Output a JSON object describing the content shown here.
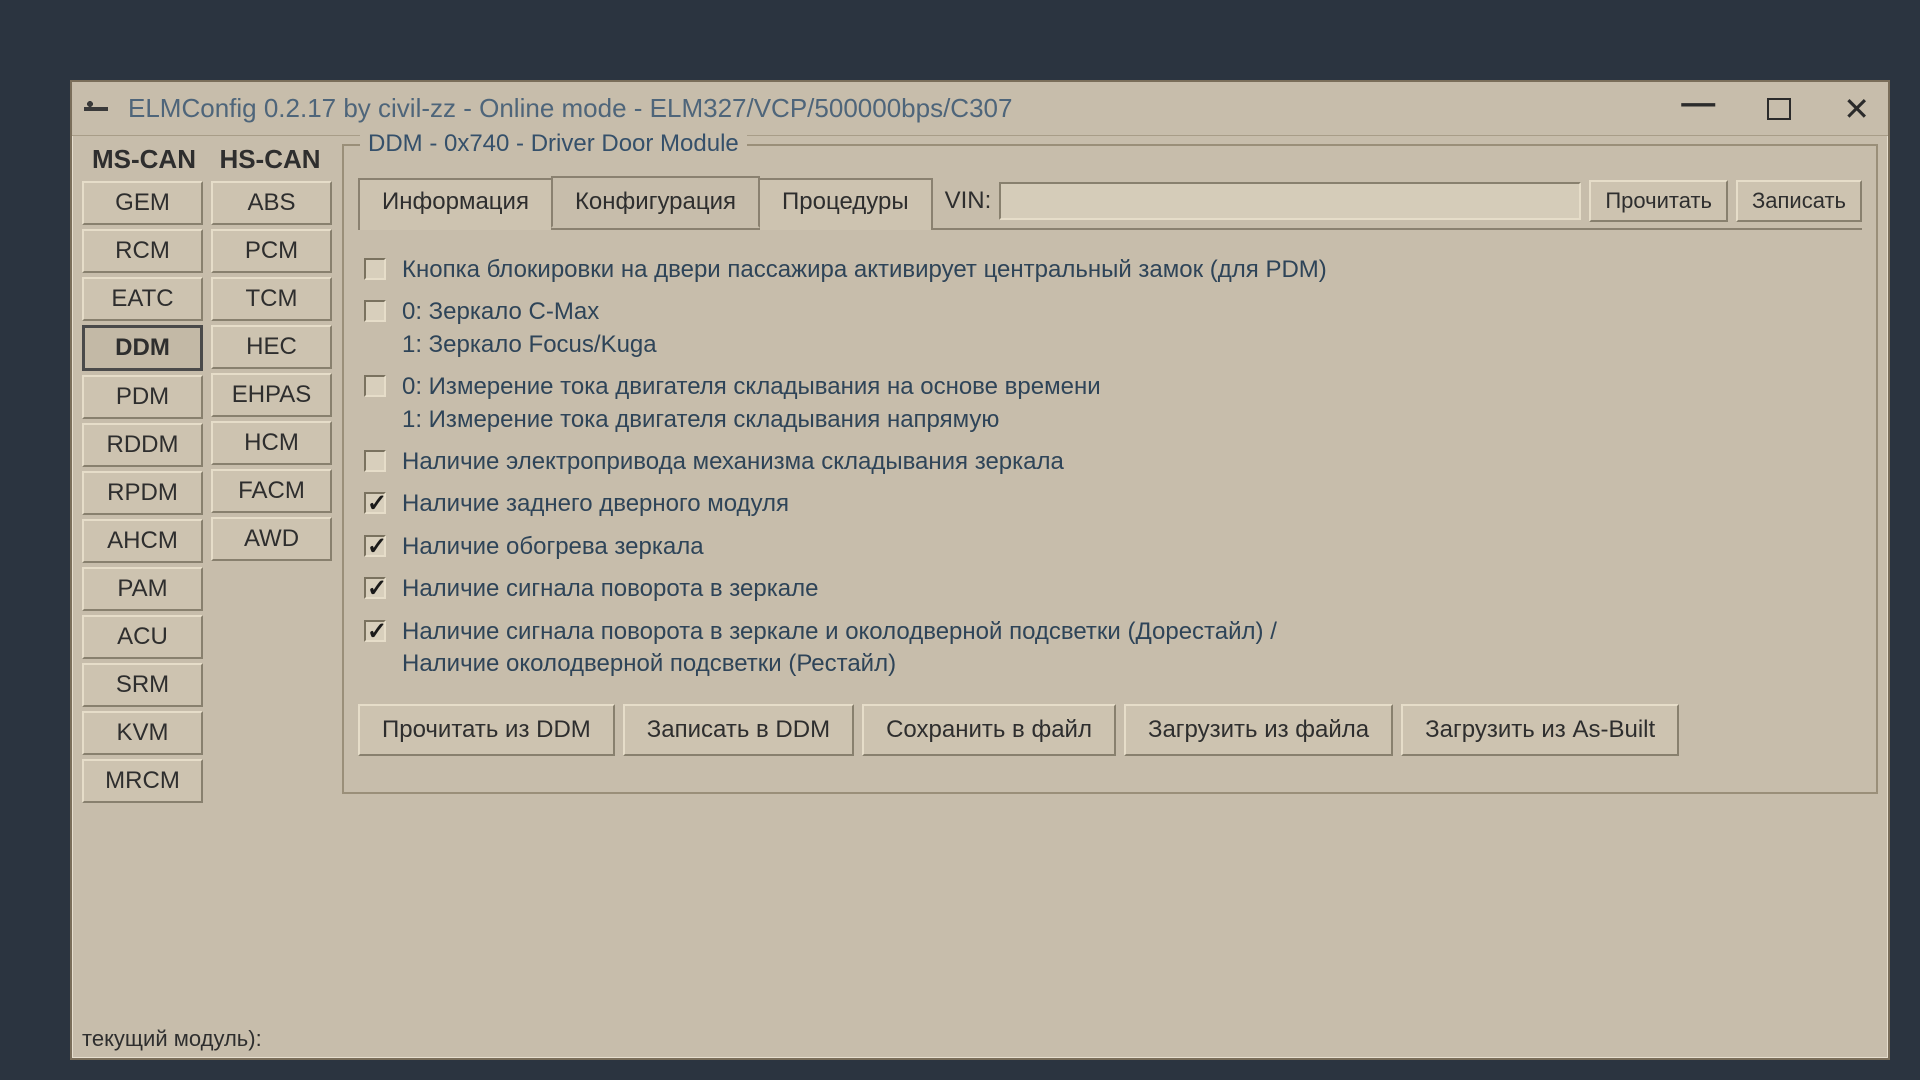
{
  "title": "ELMConfig 0.2.17 by civil-zz - Online mode - ELM327/VCP/500000bps/C307",
  "sidebar": {
    "header_ms": "MS-CAN",
    "header_hs": "HS-CAN",
    "ms": [
      "GEM",
      "RCM",
      "EATC",
      "DDM",
      "PDM",
      "RDDM",
      "RPDM",
      "AHCM",
      "PAM",
      "ACU",
      "SRM",
      "KVM",
      "MRCM"
    ],
    "hs": [
      "ABS",
      "PCM",
      "TCM",
      "HEC",
      "EHPAS",
      "HCM",
      "FACM",
      "AWD"
    ],
    "selected": "DDM",
    "current_label": "текущий модуль):"
  },
  "panel": {
    "title": "DDM - 0x740 - Driver Door Module",
    "tabs": [
      "Информация",
      "Конфигурация",
      "Процедуры"
    ],
    "active_tab": 1,
    "vin_label": "VIN:",
    "vin_value": "",
    "read_btn": "Прочитать",
    "write_btn": "Записать"
  },
  "options": [
    {
      "checked": false,
      "text": "Кнопка блокировки на двери пассажира активирует центральный замок (для PDM)"
    },
    {
      "checked": false,
      "text": "0: Зеркало C-Max\n1: Зеркало Focus/Kuga"
    },
    {
      "checked": false,
      "text": "0: Измерение тока двигателя складывания на основе времени\n1: Измерение тока двигателя складывания напрямую"
    },
    {
      "checked": false,
      "text": "Наличие электропривода механизма складывания зеркала"
    },
    {
      "checked": true,
      "text": "Наличие заднего дверного модуля"
    },
    {
      "checked": true,
      "text": "Наличие обогрева зеркала"
    },
    {
      "checked": true,
      "text": "Наличие сигнала поворота в зеркале"
    },
    {
      "checked": true,
      "text": "Наличие сигнала поворота в зеркале и околодверной подсветки (Дорестайл) /\nНаличие околодверной подсветки (Рестайл)"
    }
  ],
  "action_buttons": [
    "Прочитать из DDM",
    "Записать в DDM",
    "Сохранить в файл",
    "Загрузить из файла",
    "Загрузить из As-Built"
  ]
}
